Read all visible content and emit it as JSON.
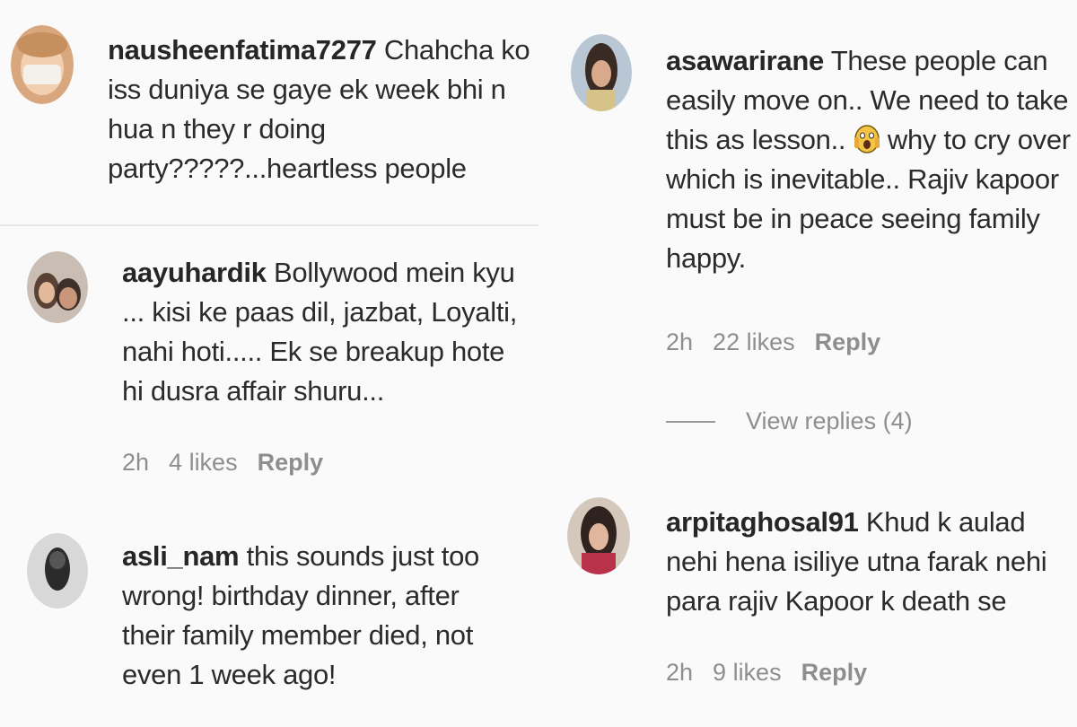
{
  "comments": [
    {
      "username": "nausheenfatima7277",
      "text": " Chahcha ko iss duniya se gaye ek week bhi n hua n they r doing party?????...heartless people"
    },
    {
      "username": "aayuhardik",
      "text": " Bollywood mein kyu ... kisi ke paas dil, jazbat, Loyalti, nahi hoti..... Ek se breakup hote hi dusra affair shuru...",
      "time": "2h",
      "likes": "4 likes",
      "reply": "Reply"
    },
    {
      "username": "asli_nam",
      "text": " this sounds just too wrong! birthday dinner, after their family member died, not even 1 week ago!"
    },
    {
      "username": "asawarirane",
      "text_before": " These people can easily move on.. We need to take this as lesson.. ",
      "emoji": "screaming-face",
      "text_after": " why to cry over which is inevitable.. Rajiv kapoor must be in peace seeing family happy.",
      "time": "2h",
      "likes": "22 likes",
      "reply": "Reply",
      "view_replies": "View replies (4)"
    },
    {
      "username": "arpitaghosal91",
      "text": " Khud k aulad nehi hena isiliye utna farak nehi para rajiv Kapoor k death se",
      "time": "2h",
      "likes": "9 likes",
      "reply": "Reply"
    }
  ]
}
